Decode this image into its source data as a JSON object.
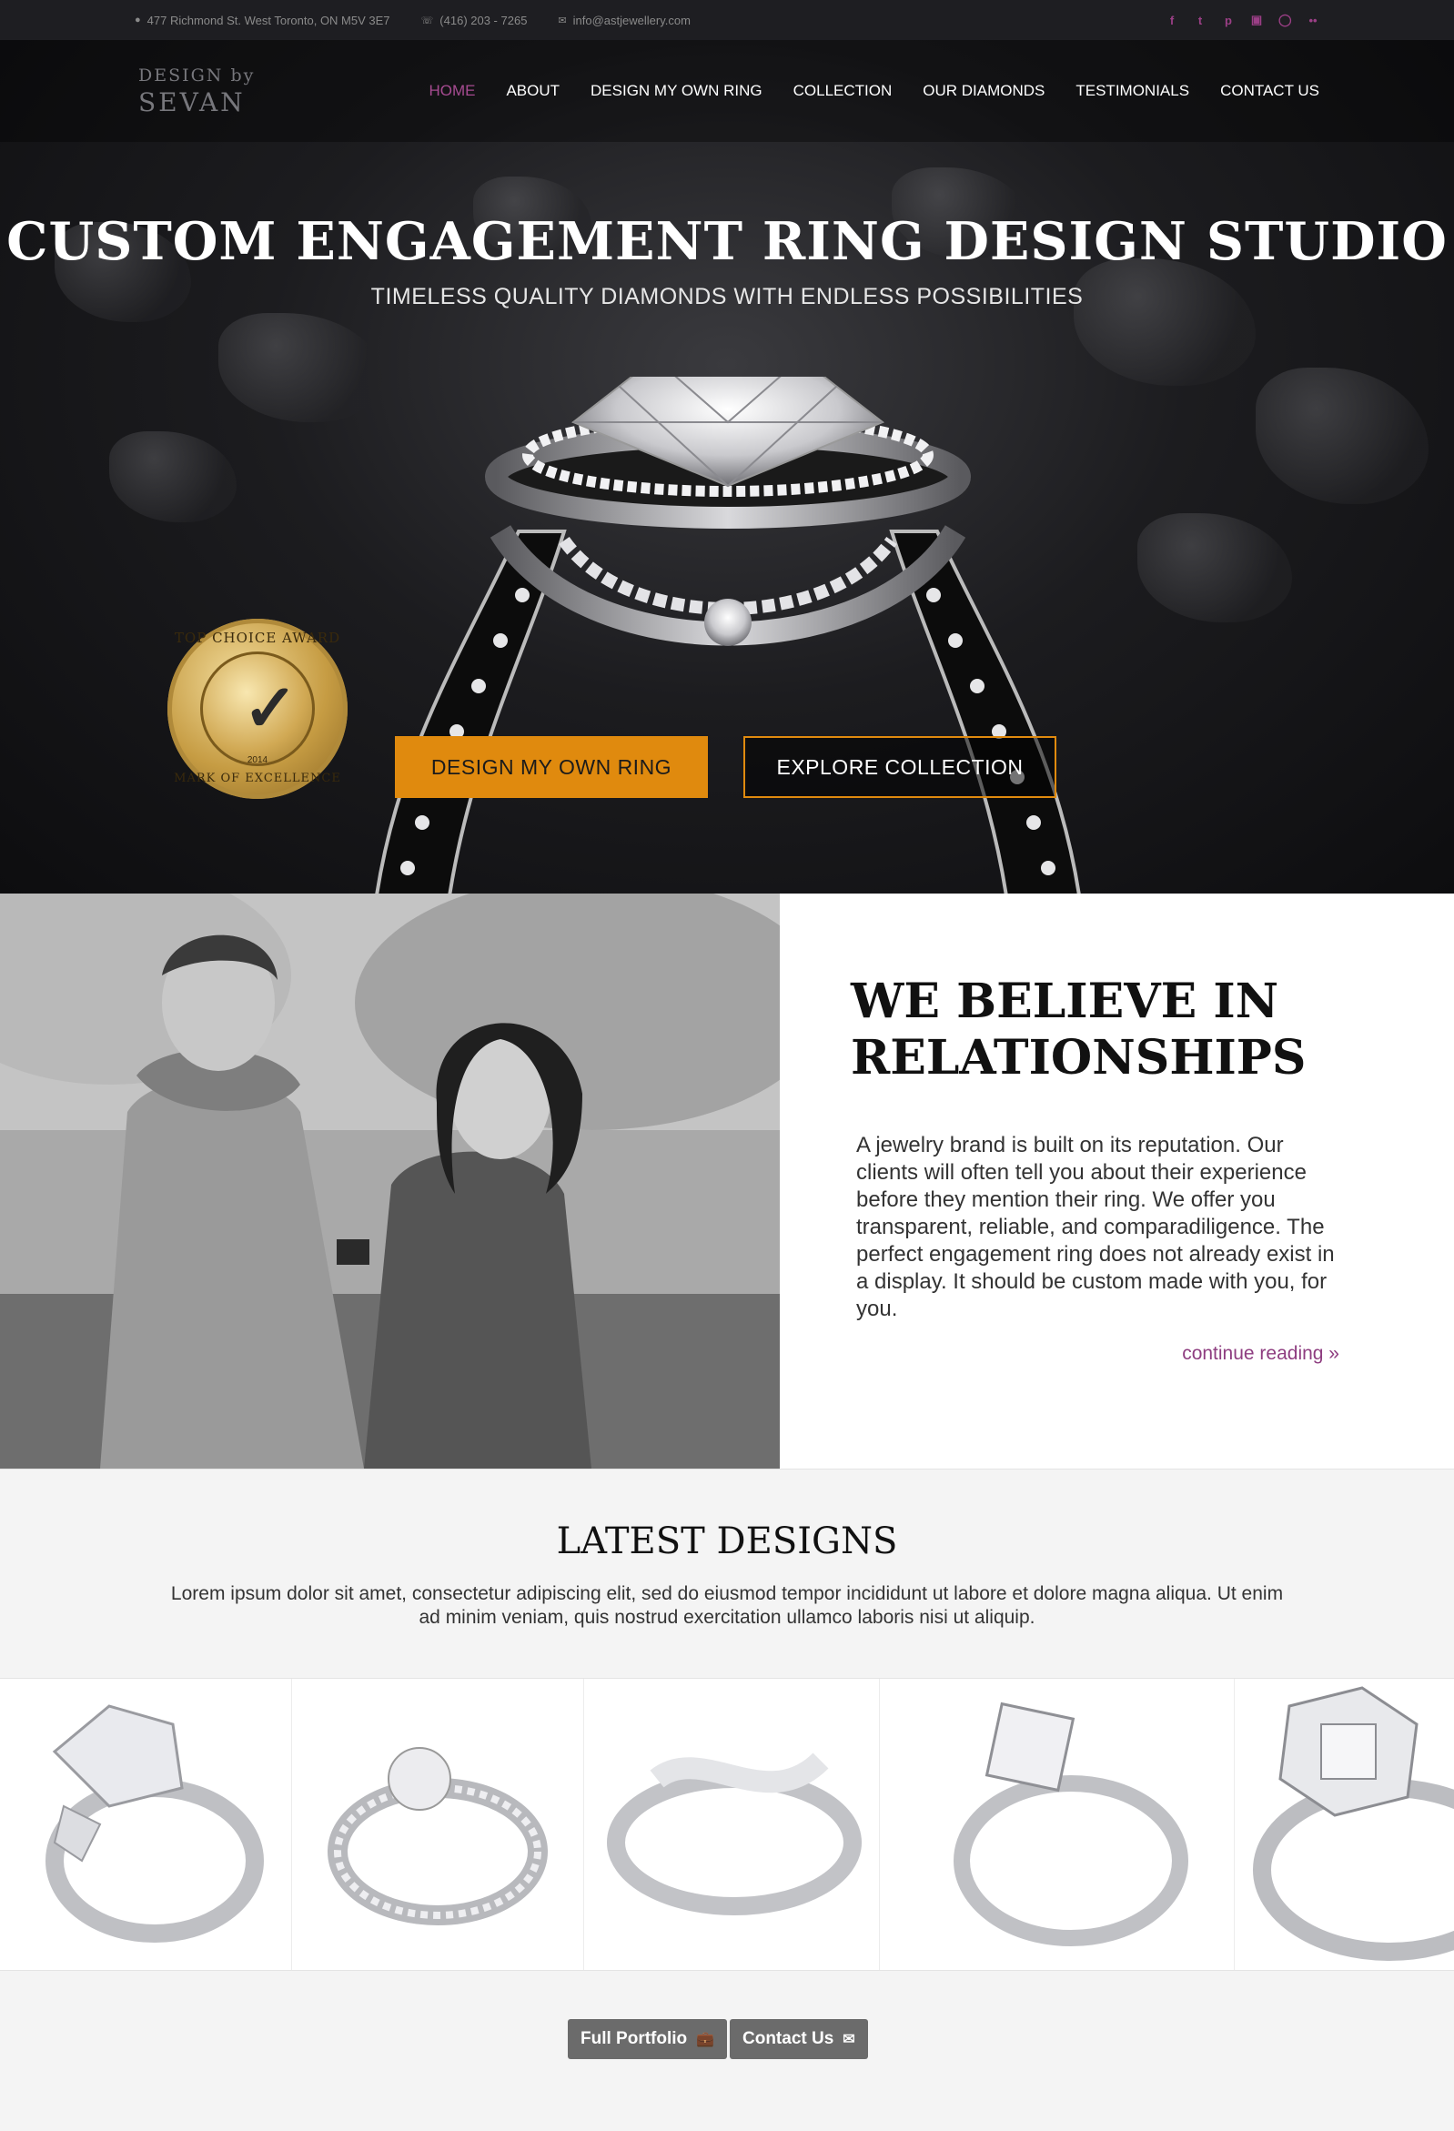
{
  "topbar": {
    "address": "477 Richmond St. West Toronto, ON M5V 3E7",
    "phone": "(416) 203 - 7265",
    "email": "info@astjewellery.com",
    "social_icons": [
      "facebook-icon",
      "twitter-icon",
      "pinterest-icon",
      "instagram-icon",
      "dribbble-icon",
      "flickr-icon"
    ]
  },
  "brand": {
    "line1": "DESIGN by",
    "line2": "SEVAN"
  },
  "nav": {
    "items": [
      "HOME",
      "ABOUT",
      "DESIGN MY OWN RING",
      "COLLECTION",
      "OUR DIAMONDS",
      "TESTIMONIALS",
      "CONTACT US"
    ],
    "active_index": 0
  },
  "hero": {
    "title": "CUSTOM ENGAGEMENT RING DESIGN STUDIO",
    "subtitle": "TIMELESS QUALITY DIAMONDS WITH ENDLESS POSSIBILITIES",
    "badge_top": "TOP CHOICE AWARD",
    "badge_bottom": "MARK OF EXCELLENCE",
    "badge_year": "2014",
    "primary_button": "DESIGN MY OWN RING",
    "secondary_button": "EXPLORE COLLECTION"
  },
  "about": {
    "title": "WE BELIEVE IN RELATIONSHIPS",
    "body": "A jewelry brand is built on its reputation. Our clients will often tell you about their experience before they mention their ring. We offer you transparent, reliable, and comparadiligence.  The perfect engagement ring does not already exist in a display. It should be custom made with you, for you.",
    "link": "continue reading »"
  },
  "latest": {
    "title": "LATEST DESIGNS",
    "description": "Lorem ipsum dolor sit amet, consectetur adipiscing elit, sed do eiusmod tempor incididunt ut labore et dolore magna aliqua. Ut enim ad minim veniam, quis nostrud exercitation ullamco laboris nisi ut aliquip."
  },
  "footer": {
    "portfolio_button": "Full Portfolio",
    "contact_button": "Contact Us"
  },
  "colors": {
    "accent_purple": "#a64b91",
    "accent_orange": "#e08a0e",
    "dark_bar": "#1e1e22"
  }
}
